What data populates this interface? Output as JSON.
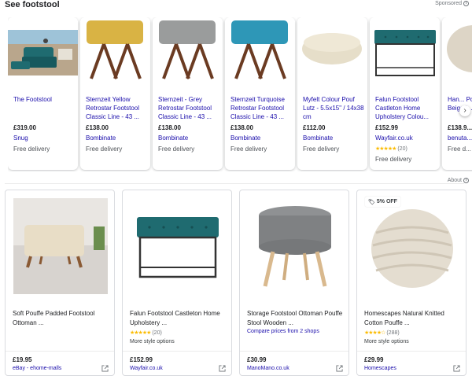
{
  "header": {
    "title": "See footstool",
    "sponsored": "Sponsored"
  },
  "about": "About",
  "ads": [
    {
      "title": "The Footstool",
      "price": "£319.00",
      "shop": "Snug",
      "delivery": "Free delivery",
      "image": "teal-sofa-beach"
    },
    {
      "title": "Sternzeit Yellow Retrostar Footstool Classic Line - 43 ...",
      "price": "£138.00",
      "shop": "Bombinate",
      "delivery": "Free delivery",
      "image": "yellow-footstool",
      "color": "#d9b344"
    },
    {
      "title": "Sternzeit - Grey Retrostar Footstool Classic Line - 43 ...",
      "price": "£138.00",
      "shop": "Bombinate",
      "delivery": "Free delivery",
      "image": "grey-footstool",
      "color": "#9a9c9c"
    },
    {
      "title": "Sternzeit Turquoise Retrostar Footstool Classic Line - 43 ...",
      "price": "£138.00",
      "shop": "Bombinate",
      "delivery": "Free delivery",
      "image": "turquoise-footstool",
      "color": "#2e97b7"
    },
    {
      "title": "Myfelt Colour Pouf Lutz - 5.5x15\" / 14x38 cm",
      "price": "£112.00",
      "shop": "Bombinate",
      "delivery": "Free delivery",
      "image": "felt-pouf"
    },
    {
      "title": "Falun Footstool Castleton Home Upholstery Colou...",
      "price": "£152.99",
      "shop": "Wayfair.co.uk",
      "rating_count": "(20)",
      "delivery": "Free delivery",
      "image": "teal-tufted-bench"
    },
    {
      "title": "Han... Pouf R... Beige/I...",
      "price": "£138.9...",
      "shop": "benuta...",
      "delivery": "Free d...",
      "image": "knit-pouf-partial"
    }
  ],
  "products": [
    {
      "title": "Soft Pouffe Padded Footstool Ottoman ...",
      "price": "£19.95",
      "seller": "eBay - ehome-malls",
      "image": "beige-bench"
    },
    {
      "title": "Falun Footstool Castleton Home Upholstery ...",
      "rating_count": "(20)",
      "extra": "More style options",
      "price": "£152.99",
      "seller": "Wayfair.co.uk",
      "image": "teal-tufted-bench"
    },
    {
      "title": "Storage Footstool Ottoman Pouffe Stool Wooden ...",
      "compare": "Compare prices from 2 shops",
      "price": "£30.99",
      "seller": "ManoMano.co.uk",
      "image": "grey-round-ottoman"
    },
    {
      "title": "Homescapes Natural Knitted Cotton Pouffe ...",
      "badge": "5% OFF",
      "rating_count": "(288)",
      "extra": "More style options",
      "price": "£29.99",
      "seller": "Homescapes",
      "image": "knitted-pouf"
    }
  ],
  "colors": {
    "link": "#1a0dab",
    "star": "#fbbc04",
    "teal": "#1f6b70"
  }
}
